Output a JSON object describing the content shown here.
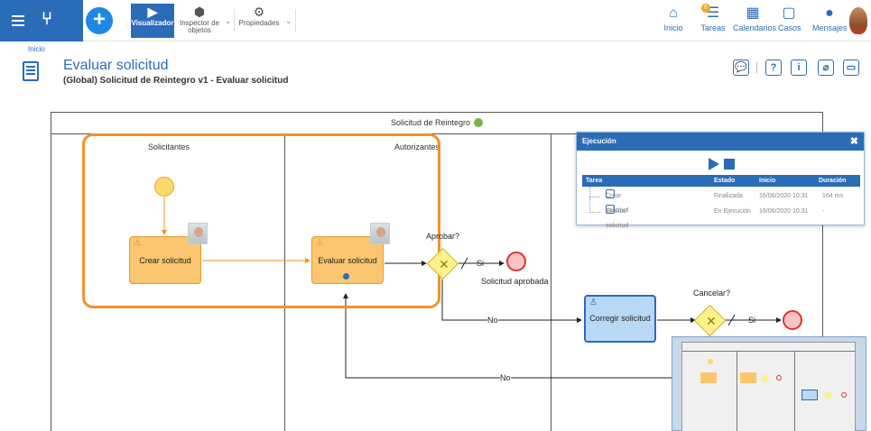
{
  "toolbar": {
    "visualizer": "Visualizador",
    "inspector": "Inspector de objetos",
    "properties": "Propiedades"
  },
  "nav": {
    "home": "Inicio",
    "tasks": "Tareas",
    "tasks_badge": "6",
    "calendars": "Calendarios",
    "cases": "Casos",
    "messages": "Mensajes"
  },
  "breadcrumb": "Inicio",
  "page": {
    "title": "Evaluar solicitud",
    "subtitle": "(Global) Solicitud de Reintegro v1 - Evaluar solicitud"
  },
  "diagram": {
    "pool": "Solicitud de Reintegro",
    "lanes": [
      "Solicitantes",
      "Autorizantes"
    ],
    "task_create": "Crear solicitud",
    "task_evaluate": "Evaluar solicitud",
    "task_correct": "Corregir solicitud",
    "gw_approve": "Aprobar?",
    "gw_cancel": "Cancelar?",
    "yes1": "Si",
    "yes2": "Si",
    "no1": "No",
    "no2": "No",
    "end_approved": "Solicitud aprobada"
  },
  "execution": {
    "title": "Ejecución",
    "close": "✖",
    "headers": [
      "Tarea",
      "Estado",
      "Inicio",
      "Duración"
    ],
    "rows": [
      {
        "task": "Crear solicitud",
        "state": "Finalizada",
        "start": "16/06/2020 10:31",
        "duration": "164 ms"
      },
      {
        "task": "Evaluar solicitud",
        "state": "En Ejecución",
        "start": "16/06/2020 10:31",
        "duration": "-"
      }
    ]
  },
  "colors": {
    "accent": "#2b6cb8",
    "highlight": "#f0932b",
    "task_orange": "#fbc66f",
    "task_blue": "#b9d8f6",
    "gateway": "#fbf28a",
    "end_event": "#e03131",
    "start_event": "#fdd86a"
  }
}
